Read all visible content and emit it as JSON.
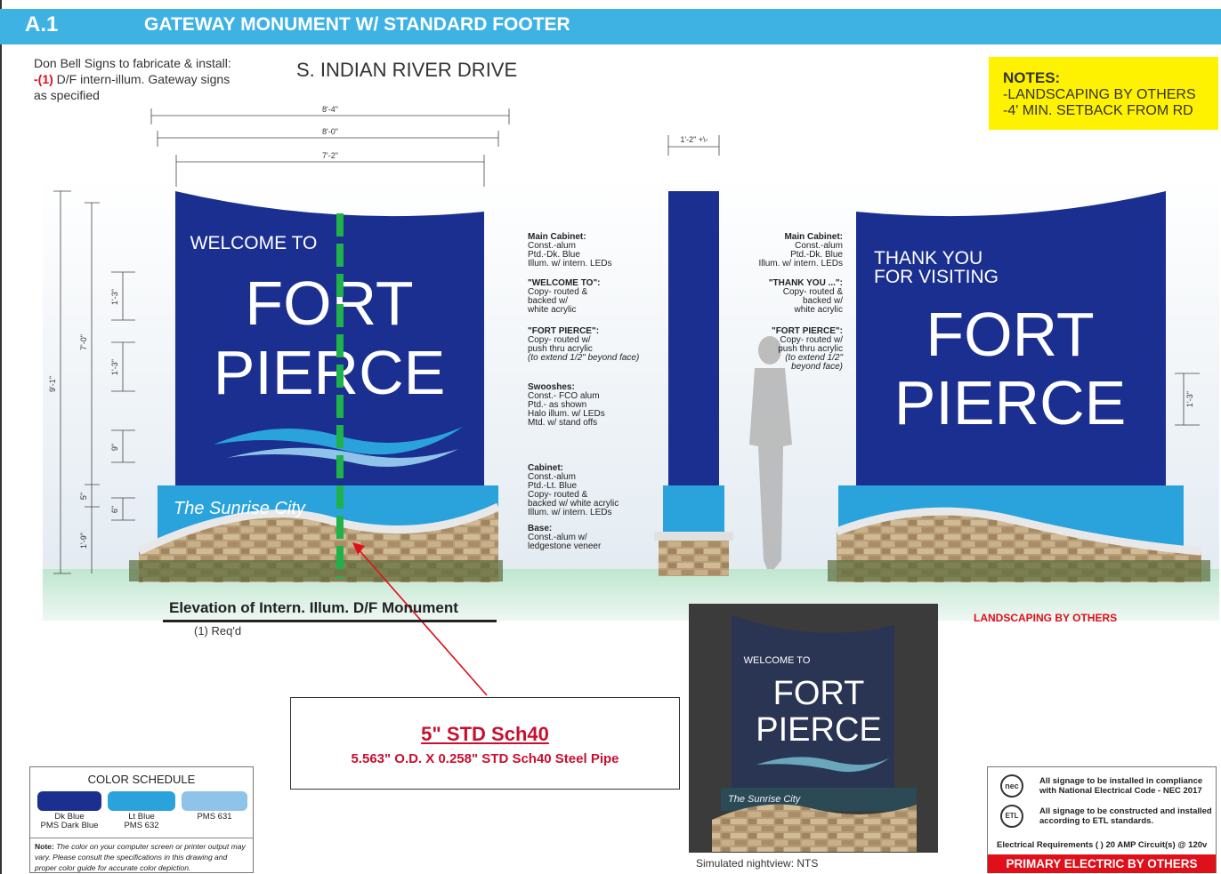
{
  "header": {
    "sheet_id": "A.1",
    "title": "GATEWAY MONUMENT W/ STANDARD FOOTER"
  },
  "intro": {
    "line1": "Don Bell Signs to fabricate & install:",
    "line2_prefix": "-",
    "line2_qty": "(1)",
    "line2_rest": " D/F intern-illum. Gateway signs",
    "line3": "as specified"
  },
  "street": "S. INDIAN RIVER DRIVE",
  "notes": {
    "title": "NOTES:",
    "lines": [
      "-LANDSCAPING BY OTHERS",
      "-4' MIN. SETBACK FROM RD"
    ]
  },
  "dimensions": {
    "width_overall": "8'-4\"",
    "width_cabinet": "8'-0\"",
    "width_face": "7'-2\"",
    "side_depth": "1'-2\" +\\-",
    "height_overall": "9'-1\"",
    "height_cabinet": "7'-0\"",
    "v1": "1'-3\"",
    "v2": "1'-3\"",
    "v3": "9\"",
    "v4": "5\"",
    "v5": "6\"",
    "v6": "1'-9\"",
    "right_v": "1'-3\""
  },
  "front_sign": {
    "welcome": "WELCOME TO",
    "line1": "FORT",
    "line2": "PIERCE",
    "tagline": "The Sunrise City"
  },
  "back_sign": {
    "thanks1": "THANK YOU",
    "thanks2": "FOR VISITING",
    "line1": "FORT",
    "line2": "PIERCE"
  },
  "specs_left": [
    {
      "title": "Main Cabinet:",
      "lines": [
        "Const.-alum",
        "Ptd.-Dk. Blue",
        "Illum. w/ intern. LEDs"
      ]
    },
    {
      "title": "\"WELCOME TO\":",
      "lines": [
        "Copy- routed &",
        "backed w/",
        "white acrylic"
      ]
    },
    {
      "title": "\"FORT PIERCE\":",
      "lines": [
        "Copy- routed w/",
        "push thru acrylic",
        "(to extend 1/2\" beyond face)"
      ]
    },
    {
      "title": "Swooshes:",
      "lines": [
        "Const.- FCO alum",
        "Ptd.- as shown",
        "Halo illum. w/ LEDs",
        "Mtd. w/ stand offs"
      ]
    },
    {
      "title": "Cabinet:",
      "lines": [
        "Const.-alum",
        "Ptd.-Lt. Blue",
        "Copy- routed &",
        "backed w/ white acrylic",
        "Illum. w/ intern. LEDs"
      ]
    },
    {
      "title": "Base:",
      "lines": [
        "Const.-alum w/",
        "ledgestone veneer"
      ]
    }
  ],
  "specs_right": [
    {
      "title": "Main Cabinet:",
      "lines": [
        "Const.-alum",
        "Ptd.-Dk. Blue",
        "Illum. w/ intern. LEDs"
      ]
    },
    {
      "title": "\"THANK YOU ...\":",
      "lines": [
        "Copy- routed &",
        "backed w/",
        "white acrylic"
      ]
    },
    {
      "title": "\"FORT PIERCE\":",
      "lines": [
        "Copy- routed w/",
        "push thru acrylic",
        "(to extend 1/2\"",
        "beyond face)"
      ]
    }
  ],
  "elevation": {
    "caption": "Elevation of Intern. Illum. D/F Monument",
    "req": "(1) Req'd"
  },
  "callout": {
    "title": "5\" STD Sch40",
    "subtitle": "5.563\" O.D. X 0.258\" STD Sch40 Steel Pipe"
  },
  "landscaping": "LANDSCAPING BY OTHERS",
  "night": {
    "welcome": "WELCOME TO",
    "line1": "FORT",
    "line2": "PIERCE",
    "tagline": "The Sunrise City",
    "caption": "Simulated nightview:  NTS"
  },
  "color_schedule": {
    "title": "COLOR SCHEDULE",
    "swatches": [
      {
        "label1": "Dk Blue",
        "label2": "PMS Dark Blue",
        "color": "#1a2f8f"
      },
      {
        "label1": "Lt Blue",
        "label2": "PMS 632",
        "color": "#2aa3dc"
      },
      {
        "label1": "PMS 631",
        "label2": "",
        "color": "#8fc3ea"
      }
    ],
    "note_label": "Note:",
    "note": " The color on your computer screen or printer output may vary. Please consult the specifications in this drawing and proper color guide for accurate color depiction."
  },
  "electrical": {
    "nec_icon": "nec",
    "etl_icon": "ETL",
    "nec_text": "All signage to be installed in compliance with National Electrical Code - NEC 2017",
    "etl_text": "All signage to be constructed and installed according to ETL standards.",
    "requirements": "Electrical Requirements  (    ) 20 AMP Circuit(s) @ 120v",
    "banner": "PRIMARY ELECTRIC BY OTHERS"
  },
  "colors": {
    "dark_blue": "#1a2f8f",
    "light_blue": "#2aa3dc",
    "header": "#3fb2e4",
    "notes_bg": "#fff200",
    "pipe": "#1fb24a",
    "red": "#e0101a"
  }
}
